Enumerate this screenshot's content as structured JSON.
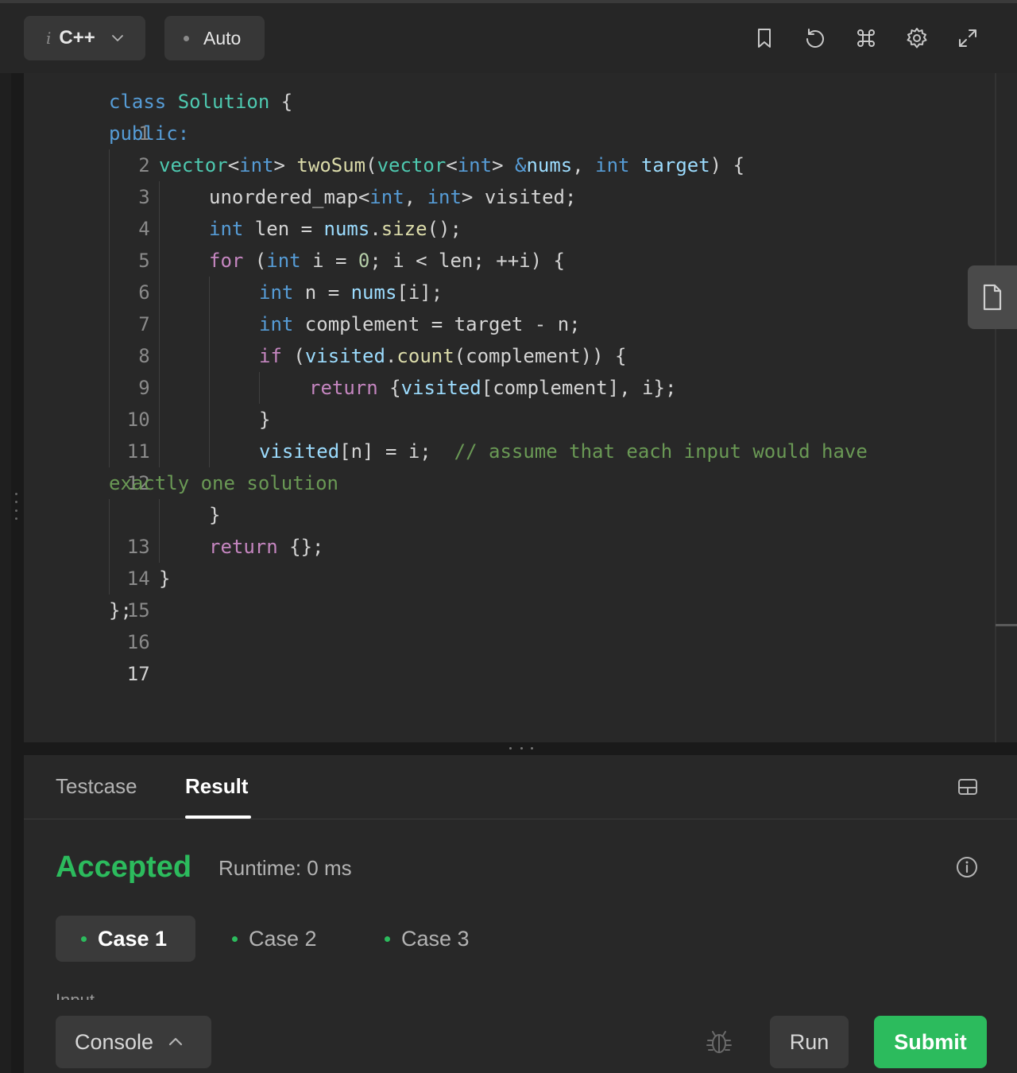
{
  "toolbar": {
    "lang_prefix": "i",
    "language": "C++",
    "mode": "Auto",
    "icons": [
      "bookmark-icon",
      "reset-icon",
      "command-icon",
      "gear-icon",
      "fullscreen-icon"
    ]
  },
  "editor": {
    "line_numbers": [
      "1",
      "2",
      "3",
      "4",
      "5",
      "6",
      "7",
      "8",
      "9",
      "10",
      "11",
      "12",
      "13",
      "14",
      "15",
      "16",
      "17"
    ],
    "code": {
      "l1_kw": "class",
      "l1_type": "Solution",
      "l1_rest": " {",
      "l2_kw": "public:",
      "l3_type": "vector",
      "l3_lt": "<",
      "l3_int": "int",
      "l3_gt": "> ",
      "l3_fn": "twoSum",
      "l3_paren": "(",
      "l3_type2": "vector",
      "l3_lt2": "<",
      "l3_int2": "int",
      "l3_gt2": "> ",
      "l3_amp": "&",
      "l3_nums": "nums",
      "l3_comma": ", ",
      "l3_int3": "int",
      "l3_sp": " ",
      "l3_target": "target",
      "l3_end": ") {",
      "l4_a": "unordered_map<",
      "l4_int": "int",
      "l4_b": ", ",
      "l4_int2": "int",
      "l4_c": "> visited;",
      "l5_int": "int",
      "l5_a": " len = ",
      "l5_nums": "nums",
      "l5_dot": ".",
      "l5_size": "size",
      "l5_b": "();",
      "l6_for": "for",
      "l6_a": " (",
      "l6_int": "int",
      "l6_b": " i = ",
      "l6_zero": "0",
      "l6_c": "; i < len; ++i) {",
      "l7_int": "int",
      "l7_a": " n = ",
      "l7_nums": "nums",
      "l7_b": "[i];",
      "l8_int": "int",
      "l8_a": " complement = target - n;",
      "l9_if": "if",
      "l9_a": " (",
      "l9_visited": "visited",
      "l9_dot": ".",
      "l9_count": "count",
      "l9_b": "(complement)) {",
      "l10_ret": "return",
      "l10_a": " {",
      "l10_visited": "visited",
      "l10_b": "[complement], i};",
      "l11": "}",
      "l12_visited": "visited",
      "l12_a": "[n] = i;  ",
      "l12_comment": "// assume that each input would have",
      "l12_wrap": "exactly one solution",
      "l13": "}",
      "l14_ret": "return",
      "l14_a": " {};",
      "l15": "}",
      "l16": "};"
    }
  },
  "result_panel": {
    "tabs": [
      "Testcase",
      "Result"
    ],
    "active_tab": "Result",
    "status": "Accepted",
    "runtime": "Runtime: 0 ms",
    "cases": [
      "Case 1",
      "Case 2",
      "Case 3"
    ],
    "selected_case": "Case 1",
    "input_label": "Input"
  },
  "bottom_bar": {
    "console": "Console",
    "run": "Run",
    "submit": "Submit"
  },
  "colors": {
    "accent_green": "#2cbb5d",
    "editor_bg": "#282828",
    "toolbar_bg": "#262626"
  }
}
